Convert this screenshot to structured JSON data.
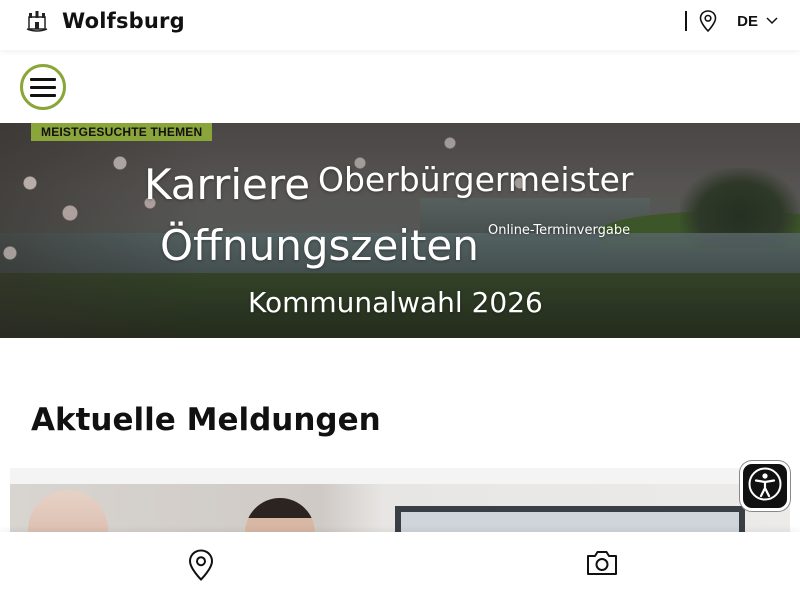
{
  "header": {
    "site_name": "Wolfsburg",
    "language": "DE",
    "icons": [
      "crest-icon",
      "location-pin-icon",
      "chevron-down-icon"
    ]
  },
  "menu": {
    "icon": "hamburger-menu-icon",
    "accent_color": "#8aa63a"
  },
  "hero": {
    "badge": "MEISTGESUCHTE THEMEN",
    "topics": {
      "karriere": "Karriere",
      "oberbuergermeister": "Oberbürgermeister",
      "oeffnungszeiten": "Öffnungszeiten",
      "online_terminvergabe": "Online-Terminvergabe",
      "kommunalwahl": "Kommunalwahl 2026"
    }
  },
  "news": {
    "title": "Aktuelle Meldungen"
  },
  "accessibility": {
    "icon": "accessibility-icon"
  },
  "bottom_bar": {
    "icons": [
      "location-pin-icon",
      "camera-icon"
    ]
  }
}
